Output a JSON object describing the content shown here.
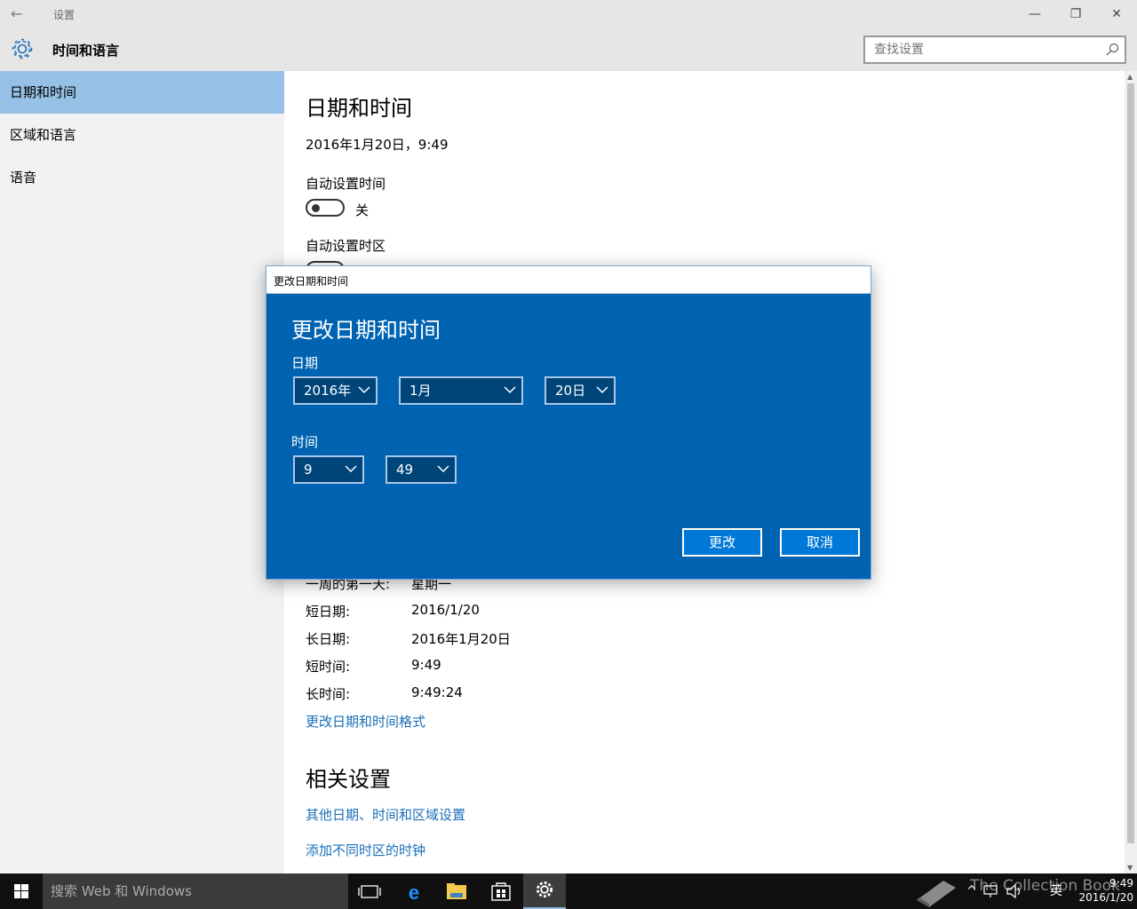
{
  "window": {
    "title": "设置",
    "back_glyph": "←",
    "min_glyph": "—",
    "max_glyph": "❐",
    "close_glyph": "✕"
  },
  "header": {
    "icon": "gear-icon",
    "section_title": "时间和语言",
    "search_placeholder": "查找设置"
  },
  "sidebar": {
    "items": [
      {
        "label": "日期和时间",
        "active": true
      },
      {
        "label": "区域和语言",
        "active": false
      },
      {
        "label": "语音",
        "active": false
      }
    ]
  },
  "main": {
    "title": "日期和时间",
    "current_datetime": "2016年1月20日，9:49",
    "auto_time_label": "自动设置时间",
    "auto_time_state": "关",
    "auto_timezone_label": "自动设置时区",
    "formats": [
      {
        "key": "一周的第一天:",
        "value": "星期一"
      },
      {
        "key": "短日期:",
        "value": "2016/1/20"
      },
      {
        "key": "长日期:",
        "value": "2016年1月20日"
      },
      {
        "key": "短时间:",
        "value": "9:49"
      },
      {
        "key": "长时间:",
        "value": "9:49:24"
      }
    ],
    "change_format_link": "更改日期和时间格式",
    "related_title": "相关设置",
    "related_links": [
      "其他日期、时间和区域设置",
      "添加不同时区的时钟"
    ]
  },
  "dialog": {
    "titlebar": "更改日期和时间",
    "heading": "更改日期和时间",
    "date_label": "日期",
    "year": "2016年",
    "month": "1月",
    "day": "20日",
    "time_label": "时间",
    "hour": "9",
    "minute": "49",
    "ok": "更改",
    "cancel": "取消"
  },
  "taskbar": {
    "search_text": "搜索 Web 和 Windows",
    "tray_ime": "英",
    "clock_time": "9:49",
    "clock_date": "2016/1/20",
    "watermark": "The Collection Book"
  },
  "colors": {
    "accent": "#0063b1",
    "sidebar_active": "#96c0e5",
    "link": "#1a6fb8"
  }
}
